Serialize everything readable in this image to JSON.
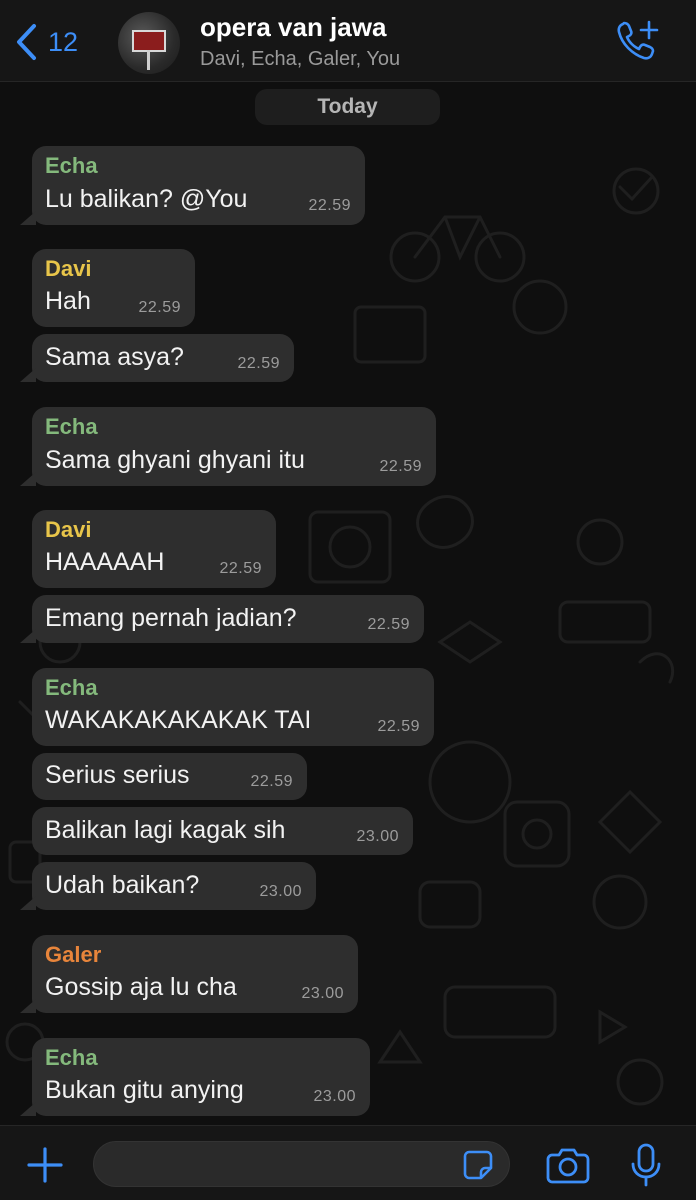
{
  "header": {
    "back_count": "12",
    "title": "opera van jawa",
    "subtitle": "Davi, Echa, Galer, You"
  },
  "chat": {
    "date_separator": "Today",
    "messages": [
      {
        "sender": "Echa",
        "text": "Lu balikan? @You",
        "time": "22.59"
      },
      {
        "sender": "Davi",
        "text": "Hah",
        "time": "22.59"
      },
      {
        "sender": "",
        "text": "Sama asya?",
        "time": "22.59"
      },
      {
        "sender": "Echa",
        "text": "Sama ghyani ghyani itu",
        "time": "22.59"
      },
      {
        "sender": "Davi",
        "text": "HAAAAAH",
        "time": "22.59"
      },
      {
        "sender": "",
        "text": "Emang pernah jadian?",
        "time": "22.59"
      },
      {
        "sender": "Echa",
        "text": "WAKAKAKAKAKAK TAI",
        "time": "22.59"
      },
      {
        "sender": "",
        "text": "Serius serius",
        "time": "22.59"
      },
      {
        "sender": "",
        "text": "Balikan lagi kagak sih",
        "time": "23.00"
      },
      {
        "sender": "",
        "text": "Udah baikan?",
        "time": "23.00"
      },
      {
        "sender": "Galer",
        "text": "Gossip aja lu cha",
        "time": "23.00"
      },
      {
        "sender": "Echa",
        "text": "Bukan gitu anying",
        "time": "23.00"
      }
    ]
  },
  "input": {
    "value": "",
    "placeholder": ""
  },
  "colors": {
    "accent": "#3d8ef7",
    "bubble": "#2e2e2e",
    "echa_name": "#84b97c",
    "davi_name": "#e8c54a",
    "galer_name": "#e8853b"
  },
  "icons": {
    "back": "chevron-left-icon",
    "call": "phone-plus-icon",
    "attach": "plus-icon",
    "sticker": "sticker-icon",
    "camera": "camera-icon",
    "mic": "microphone-icon"
  }
}
